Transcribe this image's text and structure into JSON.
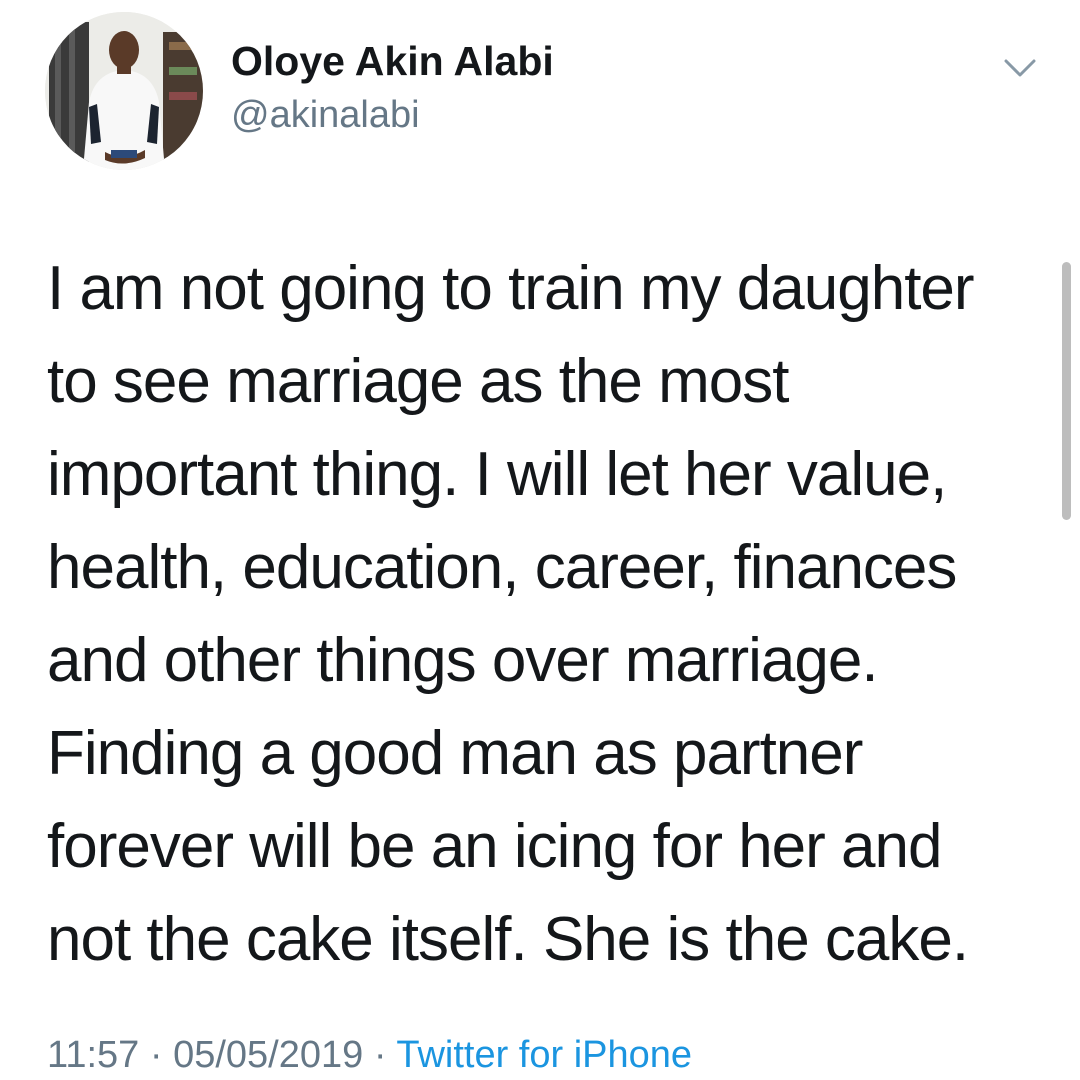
{
  "author": {
    "display_name": "Oloye Akin Alabi",
    "handle": "@akinalabi",
    "avatar_icon": "profile-photo"
  },
  "menu": {
    "icon": "chevron-down-icon"
  },
  "tweet": {
    "text": "I am not going to train my daughter\nto see marriage as the most\nimportant thing. I will let her value,\nhealth, education, career, finances\nand other things over marriage.\nFinding a good man as partner\nforever will be an icing for her and\nnot the cake itself. She is the cake.",
    "time": "11:57",
    "date": "05/05/2019",
    "separator": "·",
    "source": "Twitter for iPhone"
  },
  "colors": {
    "link": "#1b95e0",
    "secondary_text": "#657786",
    "primary_text": "#14171a"
  }
}
